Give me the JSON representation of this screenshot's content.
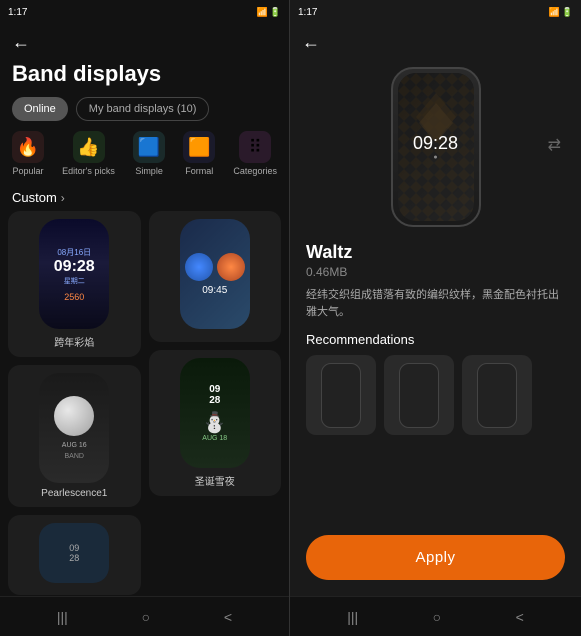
{
  "left": {
    "statusBar": {
      "time": "1:17",
      "icons": "status-icons"
    },
    "backLabel": "←",
    "title": "Band displays",
    "tabs": [
      {
        "id": "online",
        "label": "Online",
        "active": true
      },
      {
        "id": "my-band",
        "label": "My band displays (10)",
        "active": false
      }
    ],
    "categories": [
      {
        "id": "popular",
        "label": "Popular",
        "emoji": "🔥",
        "colorClass": "cat-popular"
      },
      {
        "id": "editors",
        "label": "Editor's picks",
        "emoji": "👍",
        "colorClass": "cat-editor"
      },
      {
        "id": "simple",
        "label": "Simple",
        "emoji": "🟦",
        "colorClass": "cat-simple"
      },
      {
        "id": "formal",
        "label": "Formal",
        "emoji": "🟧",
        "colorClass": "cat-formal"
      },
      {
        "id": "categories",
        "label": "Categories",
        "emoji": "⠿",
        "colorClass": "cat-categories"
      }
    ],
    "customHeader": "Custom",
    "cards": [
      {
        "id": "fireworks",
        "label": "跨年彩焰",
        "type": "fireworks"
      },
      {
        "id": "pearl",
        "label": "Pearlescence1",
        "type": "pearl"
      },
      {
        "id": "custom1",
        "label": "",
        "type": "custom1"
      },
      {
        "id": "christmas",
        "label": "圣诞雪夜",
        "type": "christmas"
      },
      {
        "id": "misc",
        "label": "",
        "type": "misc"
      }
    ]
  },
  "right": {
    "statusBar": {
      "time": "1:17",
      "icons": "status-icons"
    },
    "backLabel": "←",
    "bandName": "Waltz",
    "bandSize": "0.46MB",
    "bandDesc": "经纬交织组成错落有致的编织纹样，黑金配色衬托出雅大气。",
    "recommendationsLabel": "Recommendations",
    "applyLabel": "Apply"
  },
  "bottomNav": {
    "items": [
      "|||",
      "○",
      "<"
    ]
  }
}
